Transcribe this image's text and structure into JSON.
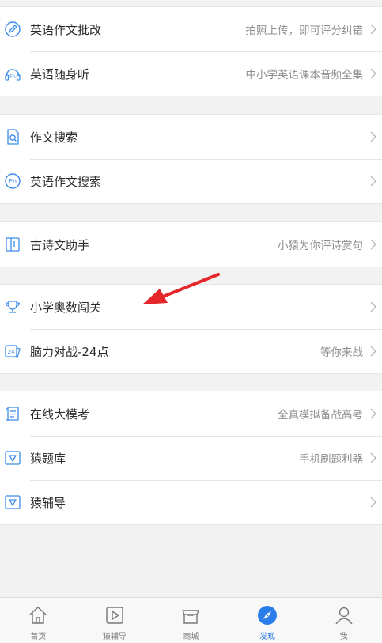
{
  "colors": {
    "accent": "#2b7de9",
    "arrow": "#e5262a"
  },
  "groups": [
    {
      "items": [
        {
          "title": "英语作文批改",
          "subtitle": "拍照上传，即可评分纠错",
          "icon": "pen-circle-icon"
        },
        {
          "title": "英语随身听",
          "subtitle": "中小学英语课本音频全集",
          "icon": "en-headphones-icon"
        }
      ]
    },
    {
      "items": [
        {
          "title": "作文搜索",
          "subtitle": "",
          "icon": "document-search-icon"
        },
        {
          "title": "英语作文搜索",
          "subtitle": "",
          "icon": "en-circle-icon"
        }
      ]
    },
    {
      "items": [
        {
          "title": "古诗文助手",
          "subtitle": "小猿为你评诗赏句",
          "icon": "book-icon"
        }
      ]
    },
    {
      "items": [
        {
          "title": "小学奥数闯关",
          "subtitle": "",
          "icon": "trophy-icon"
        },
        {
          "title": "脑力对战-24点",
          "subtitle": "等你来战",
          "icon": "card-24-icon"
        }
      ]
    },
    {
      "items": [
        {
          "title": "在线大模考",
          "subtitle": "全真模拟备战高考",
          "icon": "exam-paper-icon"
        },
        {
          "title": "猿题库",
          "subtitle": "手机刷题利器",
          "icon": "shield-app-icon"
        },
        {
          "title": "猿辅导",
          "subtitle": "",
          "icon": "shield-app-icon"
        }
      ]
    }
  ],
  "tabbar": [
    {
      "label": "首页",
      "icon": "home-icon",
      "active": false
    },
    {
      "label": "猿辅导",
      "icon": "play-icon",
      "active": false
    },
    {
      "label": "商城",
      "icon": "store-icon",
      "active": false
    },
    {
      "label": "发现",
      "icon": "compass-icon",
      "active": true
    },
    {
      "label": "我",
      "icon": "person-icon",
      "active": false
    }
  ]
}
